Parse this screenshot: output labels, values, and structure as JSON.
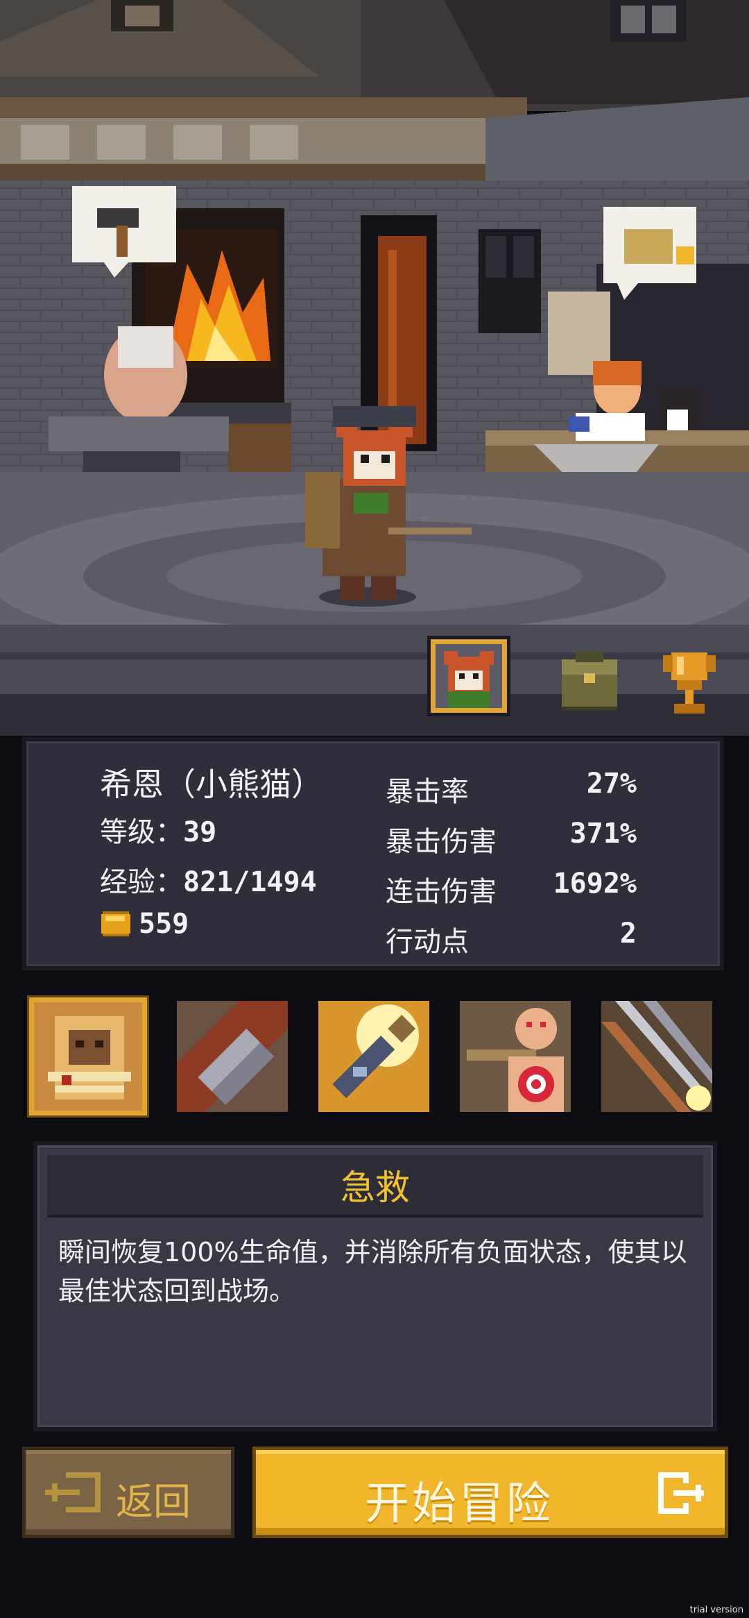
{
  "hero": {
    "name": "希恩（小熊猫）",
    "level_label": "等级：",
    "level": "39",
    "exp_label": "经验：",
    "exp": "821/1494",
    "coins": "559"
  },
  "stats": [
    {
      "label": "暴击率",
      "value": "27%"
    },
    {
      "label": "暴击伤害",
      "value": "371%"
    },
    {
      "label": "连击伤害",
      "value": "1692%"
    },
    {
      "label": "行动点",
      "value": "2"
    }
  ],
  "tabs": [
    "hero-portrait-icon",
    "backpack-icon",
    "trophy-icon"
  ],
  "skills": [
    {
      "icon": "rescue-skill-icon",
      "selected": true
    },
    {
      "icon": "claw-skill-icon",
      "selected": false
    },
    {
      "icon": "bottle-skill-icon",
      "selected": false
    },
    {
      "icon": "target-dummy-skill-icon",
      "selected": false
    },
    {
      "icon": "arrows-skill-icon",
      "selected": false
    }
  ],
  "skill_detail": {
    "title": "急救",
    "description": "瞬间恢复100%生命值，并消除所有负面状态，使其以最佳状态回到战场。"
  },
  "buttons": {
    "back": "返回",
    "start": "开始冒险"
  },
  "watermark": "trial version",
  "colors": {
    "accent_gold": "#f2b62a",
    "title_gold": "#f1c232",
    "panel": "#302e3a",
    "back_button": "#7b6446"
  }
}
